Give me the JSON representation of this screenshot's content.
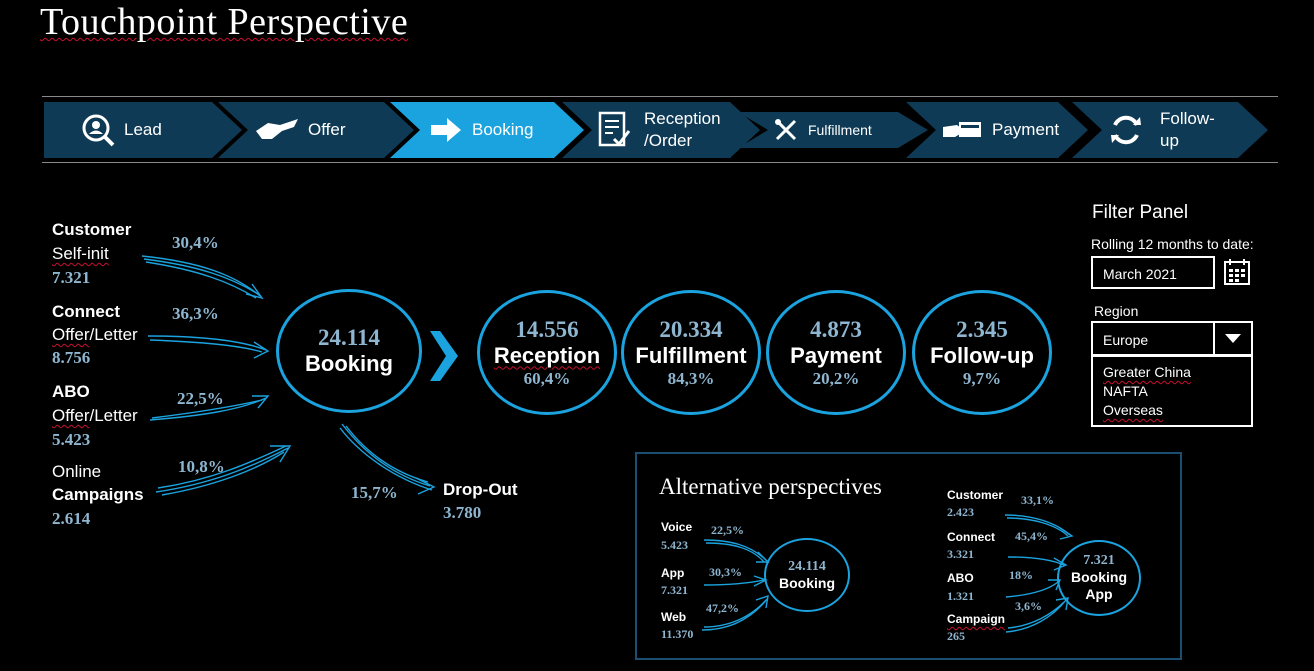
{
  "title": "Touchpoint Perspective",
  "steps": [
    {
      "label": "Lead",
      "icon": "person-search-icon"
    },
    {
      "label": "Offer",
      "icon": "handshake-icon"
    },
    {
      "label": "Booking",
      "icon": "arrow-right-icon"
    },
    {
      "label": "Reception /Order",
      "label_line1": "Reception",
      "label_line2": "/Order",
      "icon": "checklist-icon"
    },
    {
      "label": "Fulfillment",
      "icon": "tools-icon"
    },
    {
      "label": "Payment",
      "icon": "payment-icon"
    },
    {
      "label": "Follow-up",
      "label_line1": "Follow-",
      "label_line2": "up",
      "icon": "refresh-icon"
    }
  ],
  "active_step": "Booking",
  "sources": [
    {
      "name": "Customer",
      "sub": "Self-init",
      "value": "7.321",
      "pct": "30,4%"
    },
    {
      "name": "Connect",
      "sub": "Offer/Letter",
      "sub1": "Offer",
      "sub2": "/Letter",
      "value": "8.756",
      "pct": "36,3%"
    },
    {
      "name": "ABO",
      "sub": "Offer/Letter",
      "sub1": "Offer",
      "sub2": "/Letter",
      "value": "5.423",
      "pct": "22,5%"
    },
    {
      "name": "Online",
      "sub": "Campaigns",
      "value": "2.614",
      "pct": "10,8%"
    }
  ],
  "booking": {
    "value": "24.114",
    "label": "Booking"
  },
  "dropout": {
    "label": "Drop-Out",
    "value": "3.780",
    "pct": "15,7%"
  },
  "stages": [
    {
      "value": "14.556",
      "label": "Reception",
      "pct": "60,4%"
    },
    {
      "value": "20.334",
      "label": "Fulfillment",
      "pct": "84,3%"
    },
    {
      "value": "4.873",
      "label": "Payment",
      "pct": "20,2%"
    },
    {
      "value": "2.345",
      "label": "Follow-up",
      "pct": "9,7%"
    }
  ],
  "filter": {
    "title": "Filter Panel",
    "period_label": "Rolling 12 months to date:",
    "period_value": "March 2021",
    "region_label": "Region",
    "region_value": "Europe",
    "region_options": [
      "Greater China",
      "NAFTA",
      "Overseas"
    ]
  },
  "alt": {
    "title": "Alternative perspectives",
    "left": {
      "items": [
        {
          "name": "Voice",
          "value": "5.423",
          "pct": "22,5%"
        },
        {
          "name": "App",
          "value": "7.321",
          "pct": "30,3%"
        },
        {
          "name": "Web",
          "value": "11.370",
          "pct": "47,2%"
        }
      ],
      "circle_value": "24.114",
      "circle_label": "Booking"
    },
    "right": {
      "items": [
        {
          "name": "Customer",
          "value": "2.423",
          "pct": "33,1%"
        },
        {
          "name": "Connect",
          "value": "3.321",
          "pct": "45,4%"
        },
        {
          "name": "ABO",
          "value": "1.321",
          "pct": "18%"
        },
        {
          "name": "Campaign",
          "value": "265",
          "pct": "3,6%"
        }
      ],
      "circle_value": "7.321",
      "circle_label1": "Booking",
      "circle_label2": "App"
    }
  },
  "colors": {
    "accent": "#1aa3df",
    "step_bg": "#0e3a55",
    "number": "#8fb6d0",
    "alt_border": "#1b4f72"
  }
}
